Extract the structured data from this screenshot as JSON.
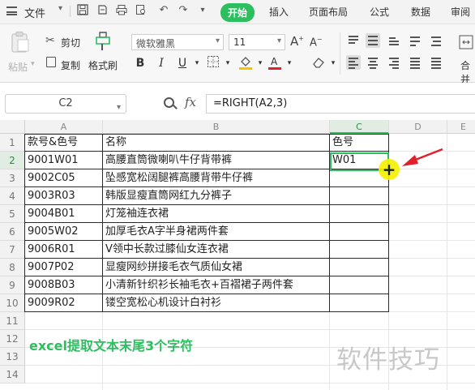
{
  "menubar": {
    "file": "文件",
    "tabs": [
      {
        "label": "开始",
        "active": true
      },
      {
        "label": "插入",
        "active": false
      },
      {
        "label": "页面布局",
        "active": false
      },
      {
        "label": "公式",
        "active": false
      },
      {
        "label": "数据",
        "active": false
      },
      {
        "label": "审阅",
        "active": false
      }
    ]
  },
  "ribbon": {
    "paste": "粘贴",
    "cut": "剪切",
    "copy": "复制",
    "format_painter": "格式刷",
    "font_name": "微软雅黑",
    "font_size": "11",
    "merge": "合并"
  },
  "formula_bar": {
    "cell_ref": "C2",
    "fx": "fx",
    "formula": "=RIGHT(A2,3)"
  },
  "grid": {
    "columns": [
      "A",
      "B",
      "C",
      "D",
      "E"
    ],
    "rows": [
      "1",
      "2",
      "3",
      "4",
      "5",
      "6",
      "7",
      "8",
      "9",
      "10",
      "11",
      "12",
      "13",
      "14"
    ],
    "headers": [
      "款号&色号",
      "名称",
      "色号"
    ],
    "data": [
      {
        "a": "9001W01",
        "b": "高腰直筒微喇叭牛仔背带裤",
        "c": "W01"
      },
      {
        "a": "9002C05",
        "b": "坠感宽松阔腿裤高腰背带牛仔裤",
        "c": ""
      },
      {
        "a": "9003R03",
        "b": "韩版显瘦直筒网红九分裤子",
        "c": ""
      },
      {
        "a": "9004B01",
        "b": "灯笼袖连衣裙",
        "c": ""
      },
      {
        "a": "9005W02",
        "b": "加厚毛衣A字半身裙两件套",
        "c": ""
      },
      {
        "a": "9006R01",
        "b": "V领中长款过膝仙女连衣裙",
        "c": ""
      },
      {
        "a": "9007P02",
        "b": "显瘦网纱拼接毛衣气质仙女裙",
        "c": ""
      },
      {
        "a": "9008B03",
        "b": "小清新针织衫长袖毛衣+百褶裙子两件套",
        "c": ""
      },
      {
        "a": "9009R02",
        "b": "镂空宽松心机设计白衬衫",
        "c": ""
      }
    ]
  },
  "caption": "excel提取文本末尾3个字符",
  "watermark": "软件技巧",
  "colors": {
    "accent": "#2dbe60",
    "arrow": "#e0202a",
    "cursor_highlight": "#f6f000"
  }
}
